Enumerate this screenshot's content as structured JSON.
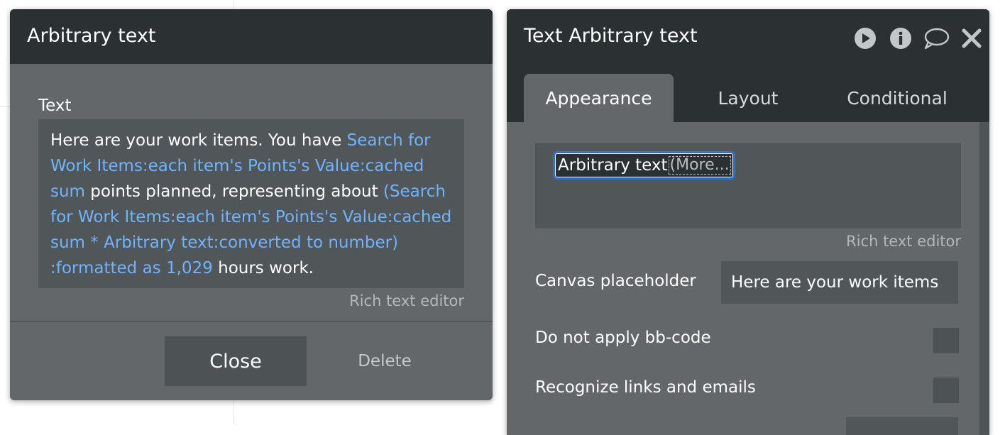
{
  "left_modal": {
    "title": "Arbitrary text",
    "field_label": "Text",
    "text_segments": [
      {
        "text": "Here are your work items. You have ",
        "dynamic": false
      },
      {
        "text": "Search for Work Items:each item's Points's Value:cached sum",
        "dynamic": true
      },
      {
        "text": " points planned, representing about  ",
        "dynamic": false
      },
      {
        "text": "(Search for Work Items:each item's Points's Value:cached sum * Arbitrary text:converted to number) :formatted as 1,029",
        "dynamic": true
      },
      {
        "text": " hours work.",
        "dynamic": false
      }
    ],
    "rich_text_label": "Rich text editor",
    "close_label": "Close",
    "delete_label": "Delete"
  },
  "right_panel": {
    "title": "Text Arbitrary text",
    "icons": [
      "play-icon",
      "info-icon",
      "comment-icon",
      "close-icon"
    ],
    "tabs": [
      {
        "label": "Appearance",
        "active": true
      },
      {
        "label": "Layout",
        "active": false
      },
      {
        "label": "Conditional",
        "active": false
      }
    ],
    "dynamic_chip": {
      "text": "Arbitrary text",
      "more": "(More..."
    },
    "rich_text_label": "Rich text editor",
    "canvas_placeholder_label": "Canvas placeholder",
    "canvas_placeholder_value": "Here are your work items",
    "bbcode_label": "Do not apply bb-code",
    "links_label": "Recognize links and emails"
  },
  "colors": {
    "header_bg": "#2b3033",
    "panel_bg": "#636769",
    "field_bg": "#515659",
    "dynamic_text": "#6fb3ff",
    "chip_border": "#2d6fd8"
  }
}
